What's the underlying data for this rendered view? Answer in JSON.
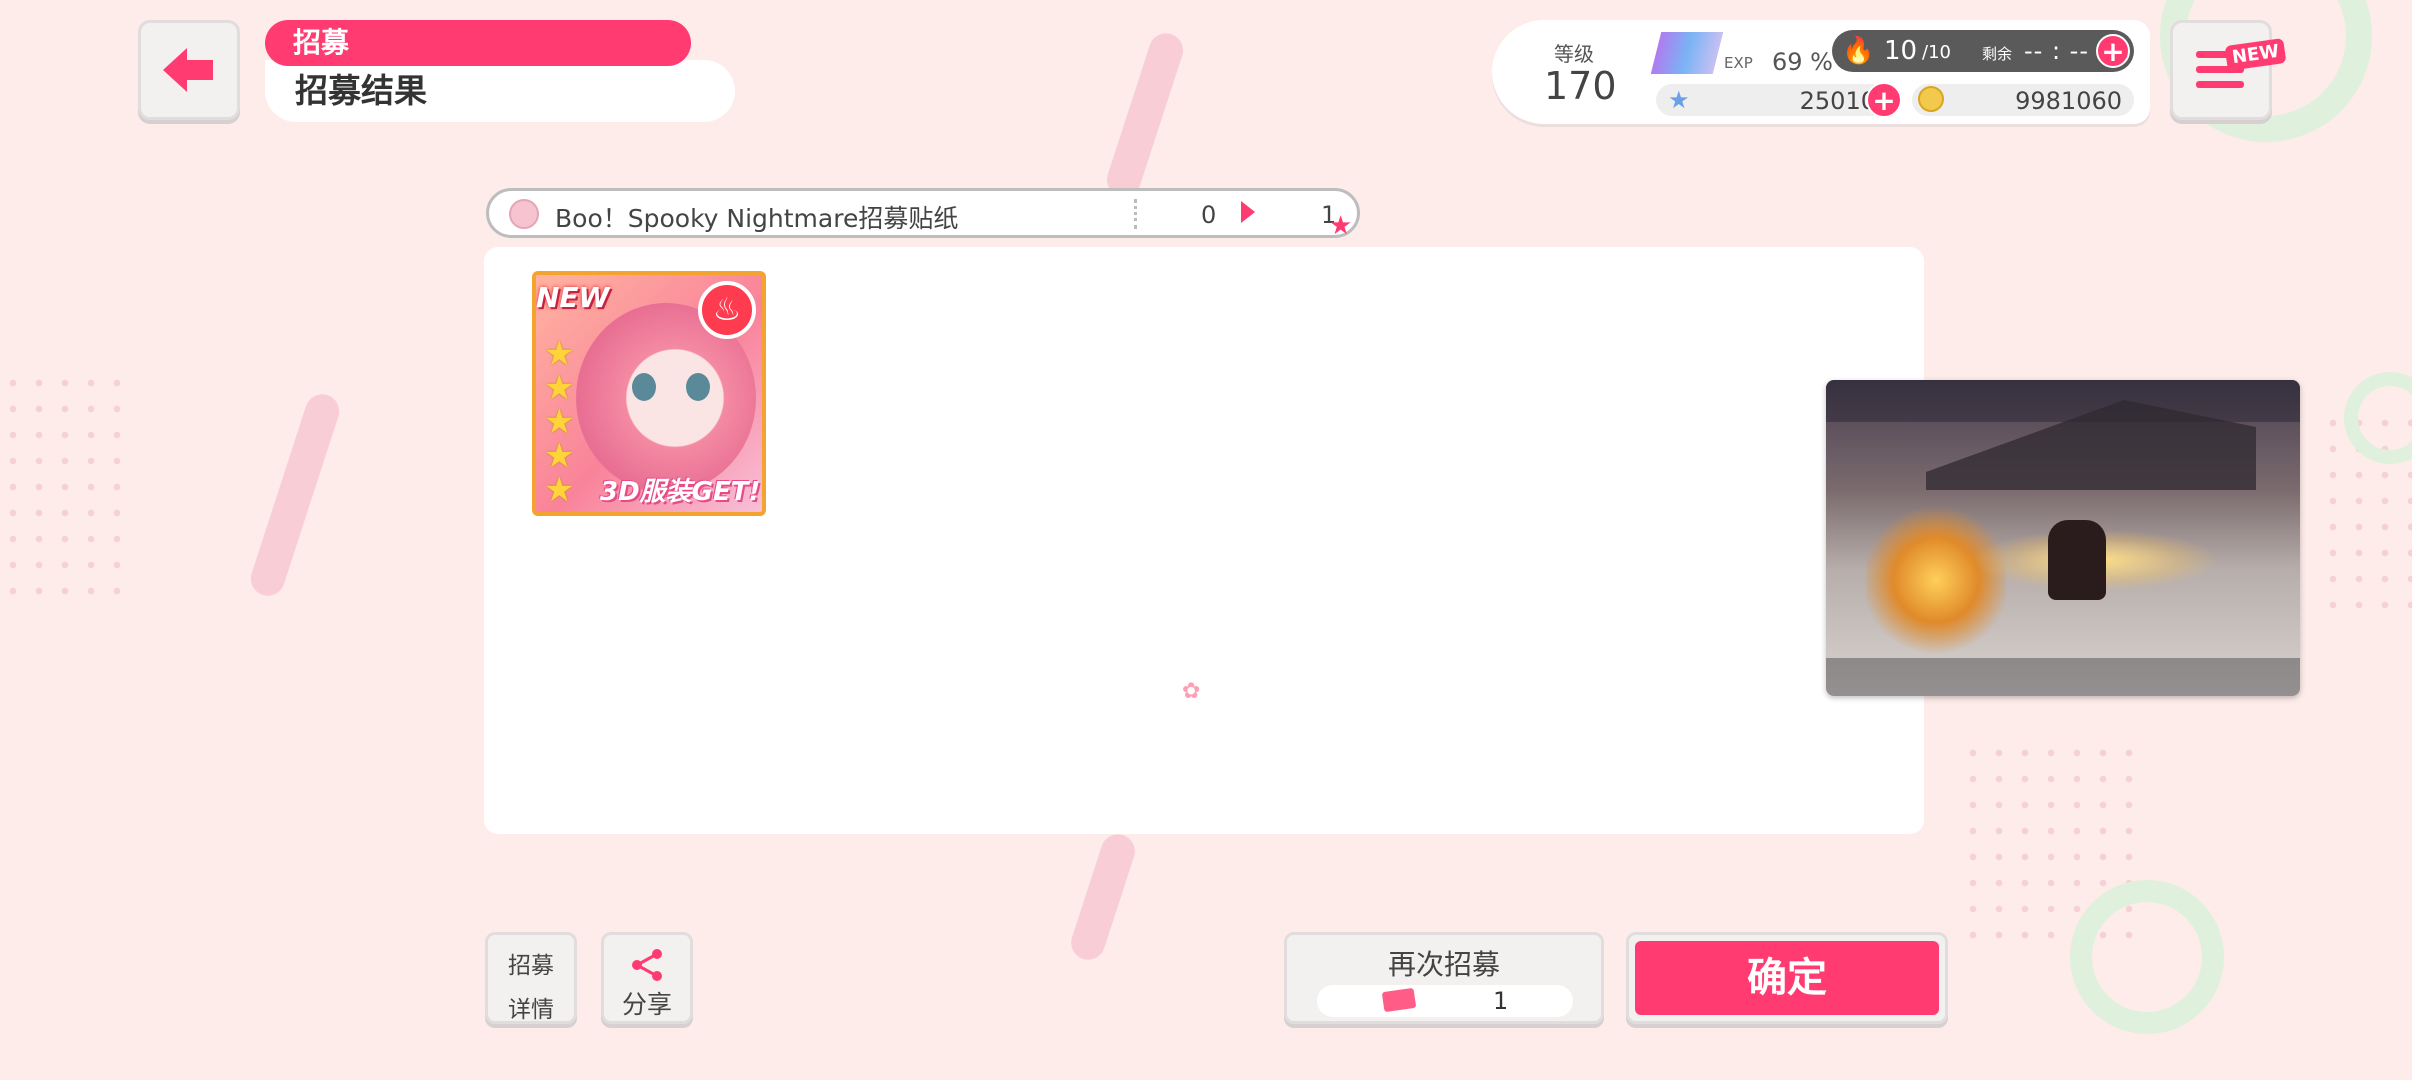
{
  "header": {
    "tab_label": "招募",
    "subtitle": "招募结果"
  },
  "status": {
    "level_label": "等级",
    "level_value": "170",
    "exp_label": "EXP",
    "exp_value": "69 %",
    "stamina_current": "10",
    "stamina_max": "/10",
    "remaining_label": "剩余",
    "remaining_value": "-- : --",
    "star_gems": "25010",
    "coins": "9981060"
  },
  "menu": {
    "new_badge": "NEW"
  },
  "gacha": {
    "name": "Boo！Spooky Nightmare招募贴纸",
    "count_from": "0",
    "count_to": "1"
  },
  "result": {
    "card": {
      "new_label": "NEW",
      "rarity": 5,
      "costume_label": "3D服装GET!"
    }
  },
  "buttons": {
    "detail": [
      "招募",
      "详情"
    ],
    "share": "分享",
    "again": "再次招募",
    "again_cost": "1",
    "confirm": "确定"
  },
  "colors": {
    "accent": "#ff3b72",
    "background": "#fdecea"
  }
}
